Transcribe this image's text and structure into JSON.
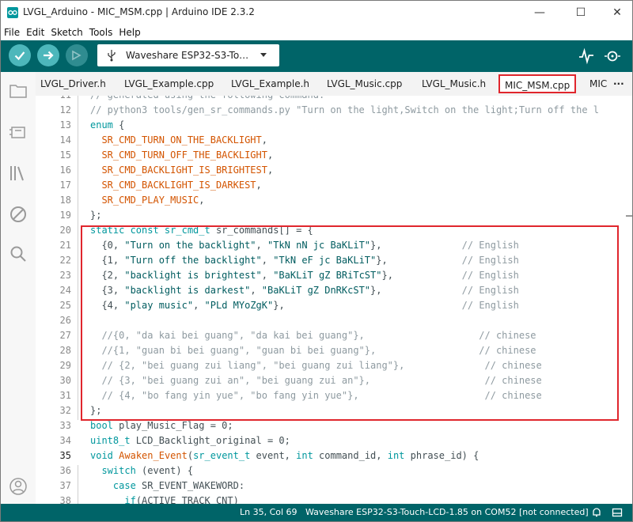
{
  "window": {
    "title": "LVGL_Arduino - MIC_MSM.cpp | Arduino IDE 2.3.2",
    "minimize": "—",
    "maximize": "☐",
    "close": "✕"
  },
  "menu": [
    "File",
    "Edit",
    "Sketch",
    "Tools",
    "Help"
  ],
  "toolbar": {
    "board": "Waveshare ESP32-S3-To…",
    "verify_icon": "check-icon",
    "upload_icon": "arrow-right-icon",
    "debug_icon": "debug-icon",
    "serial_plotter_icon": "pulse-icon",
    "serial_monitor_icon": "magnifier-icon"
  },
  "tabs": [
    "LVGL_Driver.h",
    "LVGL_Example.cpp",
    "LVGL_Example.h",
    "LVGL_Music.cpp",
    "LVGL_Music.h",
    "MIC_MSM.cpp",
    "MIC"
  ],
  "active_tab": "MIC_MSM.cpp",
  "tabs_more": "···",
  "sidebar": [
    "folder-icon",
    "boards-icon",
    "library-icon",
    "debug-disabled-icon",
    "search-icon",
    "account-icon"
  ],
  "code": [
    {
      "n": "11",
      "segs": [
        [
          "cm",
          "// generated using the following command:"
        ]
      ]
    },
    {
      "n": "12",
      "segs": [
        [
          "cm",
          "// python3 tools/gen_sr_commands.py \"Turn on the light,Switch on the light;Turn off the l"
        ]
      ]
    },
    {
      "n": "13",
      "segs": [
        [
          "kw",
          "enum"
        ],
        [
          "",
          " {"
        ]
      ]
    },
    {
      "n": "14",
      "segs": [
        [
          "",
          "  "
        ],
        [
          "mc",
          "SR_CMD_TURN_ON_THE_BACKLIGHT"
        ],
        [
          "",
          ","
        ]
      ]
    },
    {
      "n": "15",
      "segs": [
        [
          "",
          "  "
        ],
        [
          "mc",
          "SR_CMD_TURN_OFF_THE_BACKLIGHT"
        ],
        [
          "",
          ","
        ]
      ]
    },
    {
      "n": "16",
      "segs": [
        [
          "",
          "  "
        ],
        [
          "mc",
          "SR_CMD_BACKLIGHT_IS_BRIGHTEST"
        ],
        [
          "",
          ","
        ]
      ]
    },
    {
      "n": "17",
      "segs": [
        [
          "",
          "  "
        ],
        [
          "mc",
          "SR_CMD_BACKLIGHT_IS_DARKEST"
        ],
        [
          "",
          ","
        ]
      ]
    },
    {
      "n": "18",
      "segs": [
        [
          "",
          "  "
        ],
        [
          "mc",
          "SR_CMD_PLAY_MUSIC"
        ],
        [
          "",
          ","
        ]
      ]
    },
    {
      "n": "19",
      "segs": [
        [
          "",
          "};"
        ]
      ]
    },
    {
      "n": "20",
      "segs": [
        [
          "kw",
          "static const sr_cmd_t"
        ],
        [
          "",
          " sr_commands[] = {"
        ]
      ]
    },
    {
      "n": "21",
      "segs": [
        [
          "",
          "  {0, "
        ],
        [
          "str",
          "\"Turn on the backlight\""
        ],
        [
          "",
          ", "
        ],
        [
          "str",
          "\"TkN nN jc BaKLiT\""
        ],
        [
          "",
          "},              "
        ],
        [
          "cm",
          "// English"
        ]
      ]
    },
    {
      "n": "22",
      "segs": [
        [
          "",
          "  {1, "
        ],
        [
          "str",
          "\"Turn off the backlight\""
        ],
        [
          "",
          ", "
        ],
        [
          "str",
          "\"TkN eF jc BaKLiT\""
        ],
        [
          "",
          "},             "
        ],
        [
          "cm",
          "// English"
        ]
      ]
    },
    {
      "n": "23",
      "segs": [
        [
          "",
          "  {2, "
        ],
        [
          "str",
          "\"backlight is brightest\""
        ],
        [
          "",
          ", "
        ],
        [
          "str",
          "\"BaKLiT gZ BRiTcST\""
        ],
        [
          "",
          "},            "
        ],
        [
          "cm",
          "// English"
        ]
      ]
    },
    {
      "n": "24",
      "segs": [
        [
          "",
          "  {3, "
        ],
        [
          "str",
          "\"backlight is darkest\""
        ],
        [
          "",
          ", "
        ],
        [
          "str",
          "\"BaKLiT gZ DnRKcST\""
        ],
        [
          "",
          "},              "
        ],
        [
          "cm",
          "// English"
        ]
      ]
    },
    {
      "n": "25",
      "segs": [
        [
          "",
          "  {4, "
        ],
        [
          "str",
          "\"play music\""
        ],
        [
          "",
          ", "
        ],
        [
          "str",
          "\"PLd MYoZgK\""
        ],
        [
          "",
          "},                               "
        ],
        [
          "cm",
          "// English"
        ]
      ]
    },
    {
      "n": "26",
      "segs": [
        [
          "",
          ""
        ]
      ]
    },
    {
      "n": "27",
      "segs": [
        [
          "cm",
          "  //{0, \"da kai bei guang\", \"da kai bei guang\"},                    // chinese"
        ]
      ]
    },
    {
      "n": "28",
      "segs": [
        [
          "cm",
          "  //{1, \"guan bi bei guang\", \"guan bi bei guang\"},                  // chinese"
        ]
      ]
    },
    {
      "n": "29",
      "segs": [
        [
          "cm",
          "  // {2, \"bei guang zui liang\", \"bei guang zui liang\"},              // chinese"
        ]
      ]
    },
    {
      "n": "30",
      "segs": [
        [
          "cm",
          "  // {3, \"bei guang zui an\", \"bei guang zui an\"},                    // chinese"
        ]
      ]
    },
    {
      "n": "31",
      "segs": [
        [
          "cm",
          "  // {4, \"bo fang yin yue\", \"bo fang yin yue\"},                      // chinese"
        ]
      ]
    },
    {
      "n": "32",
      "segs": [
        [
          "",
          "};"
        ]
      ]
    },
    {
      "n": "33",
      "segs": [
        [
          "kw",
          "bool"
        ],
        [
          "",
          " play_Music_Flag = 0;"
        ]
      ]
    },
    {
      "n": "34",
      "segs": [
        [
          "kw",
          "uint8_t"
        ],
        [
          "",
          " LCD_Backlight_original = 0;"
        ]
      ]
    },
    {
      "n": "35",
      "segs": [
        [
          "kw",
          "void"
        ],
        [
          "",
          " "
        ],
        [
          "fn",
          "Awaken_Event"
        ],
        [
          "",
          "("
        ],
        [
          "kw",
          "sr_event_t"
        ],
        [
          "",
          " event, "
        ],
        [
          "kw",
          "int"
        ],
        [
          "",
          " command_id, "
        ],
        [
          "kw",
          "int"
        ],
        [
          "",
          " phrase_id) {"
        ]
      ]
    },
    {
      "n": "36",
      "segs": [
        [
          "",
          "  "
        ],
        [
          "kw",
          "switch"
        ],
        [
          "",
          " (event) {"
        ]
      ]
    },
    {
      "n": "37",
      "segs": [
        [
          "",
          "    "
        ],
        [
          "kw",
          "case"
        ],
        [
          "",
          " SR_EVENT_WAKEWORD:"
        ]
      ]
    },
    {
      "n": "38",
      "segs": [
        [
          "",
          "      "
        ],
        [
          "kw",
          "if"
        ],
        [
          "",
          "(ACTIVE_TRACK_CNT)"
        ]
      ]
    }
  ],
  "status": {
    "position": "Ln 35, Col 69",
    "board": "Waveshare ESP32-S3-Touch-LCD-1.85 on COM52 [not connected]",
    "notifications_icon": "bell-icon",
    "output_icon": "output-panel-icon"
  },
  "colors": {
    "toolbar": "#006468",
    "button": "#4db7bb",
    "highlight_box": "#e0262d",
    "keyword": "#00979d",
    "macro": "#d35400",
    "comment": "#8e9aa0"
  }
}
